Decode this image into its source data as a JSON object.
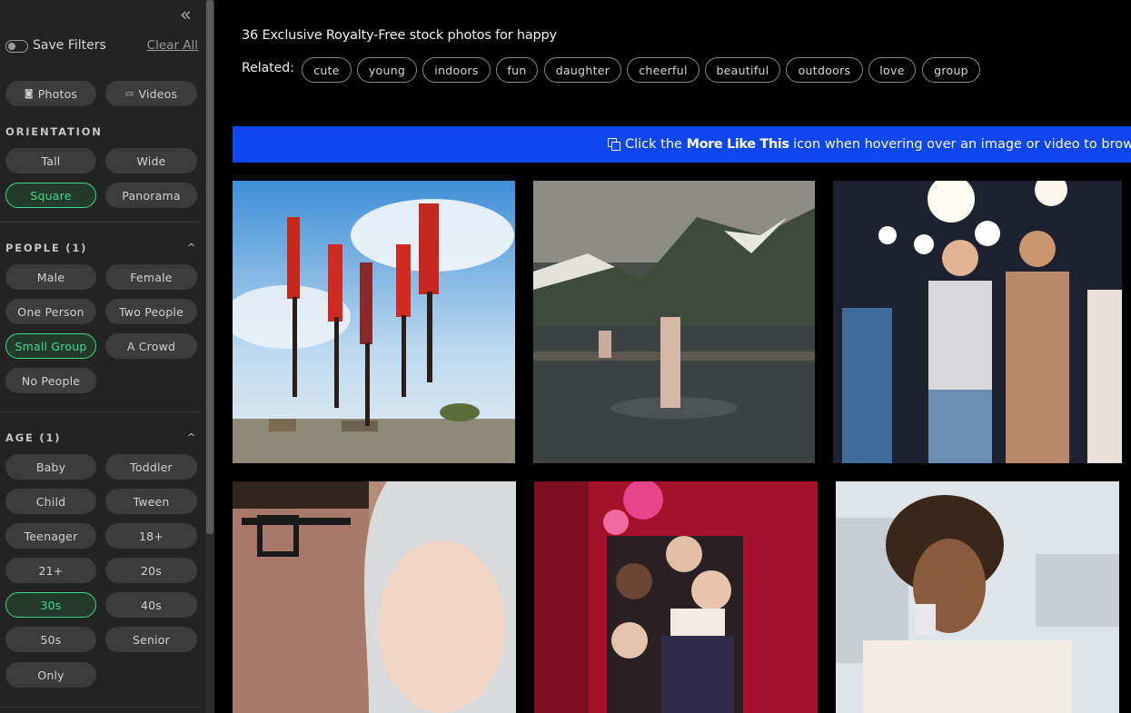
{
  "sidebar": {
    "collapse_icon": "chevrons-left-icon",
    "save_filters_label": "Save Filters",
    "clear_all_label": "Clear All",
    "media_type": [
      {
        "label": "Photos",
        "icon": "camera-icon"
      },
      {
        "label": "Videos",
        "icon": "video-camera-icon"
      }
    ],
    "orientation": {
      "title": "ORIENTATION",
      "options": [
        {
          "label": "Tall",
          "selected": false
        },
        {
          "label": "Wide",
          "selected": false
        },
        {
          "label": "Square",
          "selected": true
        },
        {
          "label": "Panorama",
          "selected": false
        }
      ]
    },
    "people": {
      "title": "PEOPLE (1)",
      "options": [
        {
          "label": "Male",
          "selected": false
        },
        {
          "label": "Female",
          "selected": false
        },
        {
          "label": "One Person",
          "selected": false
        },
        {
          "label": "Two People",
          "selected": false
        },
        {
          "label": "Small Group",
          "selected": true
        },
        {
          "label": "A Crowd",
          "selected": false
        },
        {
          "label": "No People",
          "selected": false
        }
      ]
    },
    "age": {
      "title": "AGE (1)",
      "options": [
        {
          "label": "Baby",
          "selected": false
        },
        {
          "label": "Toddler",
          "selected": false
        },
        {
          "label": "Child",
          "selected": false
        },
        {
          "label": "Tween",
          "selected": false
        },
        {
          "label": "Teenager",
          "selected": false
        },
        {
          "label": "18+",
          "selected": false
        },
        {
          "label": "21+",
          "selected": false
        },
        {
          "label": "20s",
          "selected": false
        },
        {
          "label": "30s",
          "selected": true
        },
        {
          "label": "40s",
          "selected": false
        },
        {
          "label": "50s",
          "selected": false
        },
        {
          "label": "Senior",
          "selected": false
        },
        {
          "label": "Only",
          "selected": false
        }
      ]
    }
  },
  "main": {
    "heading": "36 Exclusive Royalty-Free stock photos for happy",
    "related_label": "Related:",
    "related_tags": [
      "cute",
      "young",
      "indoors",
      "fun",
      "daughter",
      "cheerful",
      "beautiful",
      "outdoors",
      "love",
      "group"
    ],
    "banner": {
      "icon": "more-like-this-icon",
      "prefix": "Click the ",
      "bold": "More Like This",
      "suffix": " icon when hovering over an image or video to browse m"
    },
    "photos": [
      {
        "subject": "Maasai warriors jumping against blue sky"
      },
      {
        "subject": "Woman standing in mountain lake"
      },
      {
        "subject": "Friends dancing at night party with string lights"
      },
      {
        "subject": "Mother kissing baby in white hood"
      },
      {
        "subject": "Group of women at party with confetti and wine"
      },
      {
        "subject": "Smiling woman talking on phone in office"
      }
    ]
  },
  "colors": {
    "sidebar_bg": "#232323",
    "pill_bg": "#3c3c3c",
    "selected_accent": "#3ddc84",
    "banner_bg": "#0d45ee",
    "page_bg": "#000000"
  }
}
